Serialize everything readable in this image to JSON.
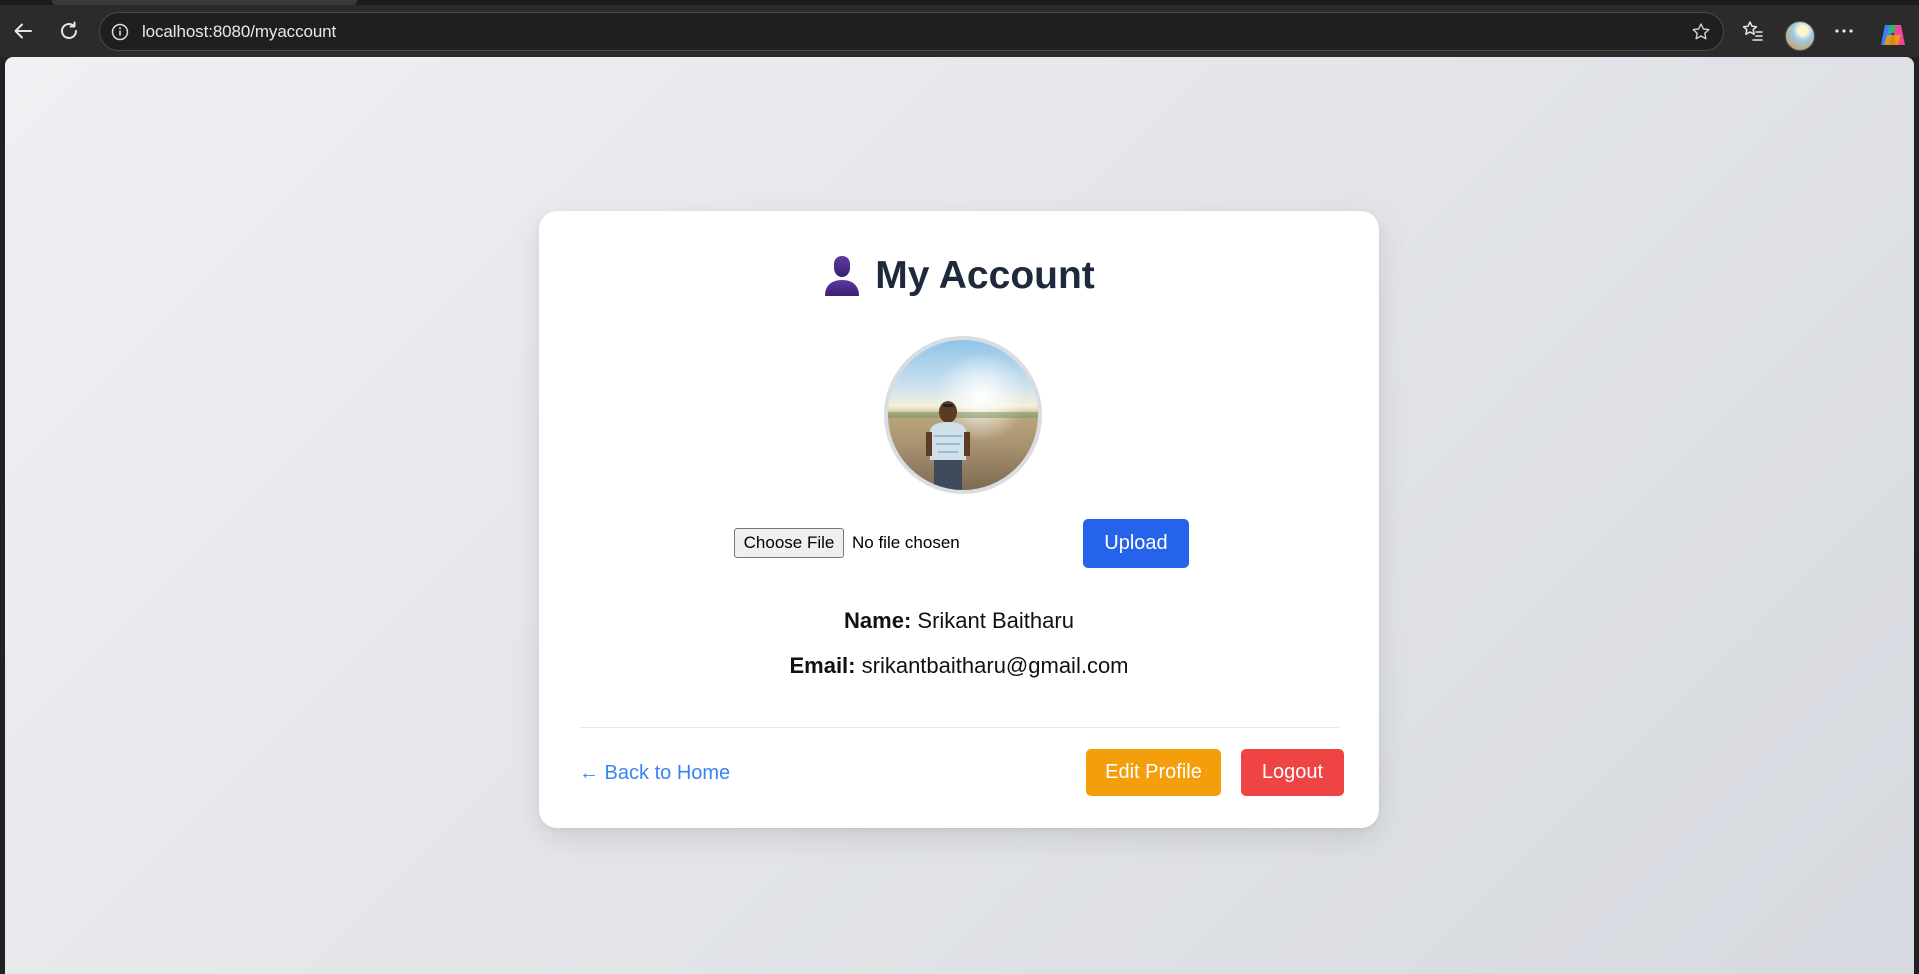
{
  "browser": {
    "url": "localhost:8080/myaccount",
    "icons": {
      "back": "back-arrow-icon",
      "reload": "reload-icon",
      "site_info": "info-icon",
      "bookmark": "star-icon",
      "favorites": "favorites-icon",
      "profile": "profile-avatar",
      "menu": "more-icon",
      "copilot": "copilot-icon"
    }
  },
  "page": {
    "title": "My Account",
    "title_icon": "user-icon",
    "upload": {
      "choose_label": "Choose File",
      "status": "No file chosen",
      "button_label": "Upload"
    },
    "profile": {
      "name_label": "Name:",
      "name_value": "Srikant Baitharu",
      "email_label": "Email:",
      "email_value": "srikantbaitharu@gmail.com"
    },
    "footer": {
      "back_link": "← Back to Home",
      "edit_label": "Edit Profile",
      "logout_label": "Logout"
    }
  },
  "colors": {
    "primary": "#2563eb",
    "edit": "#f59e0b",
    "logout": "#ef4444",
    "link": "#3b82f6",
    "title": "#1e293b",
    "title_icon": "#4c2a8a"
  }
}
